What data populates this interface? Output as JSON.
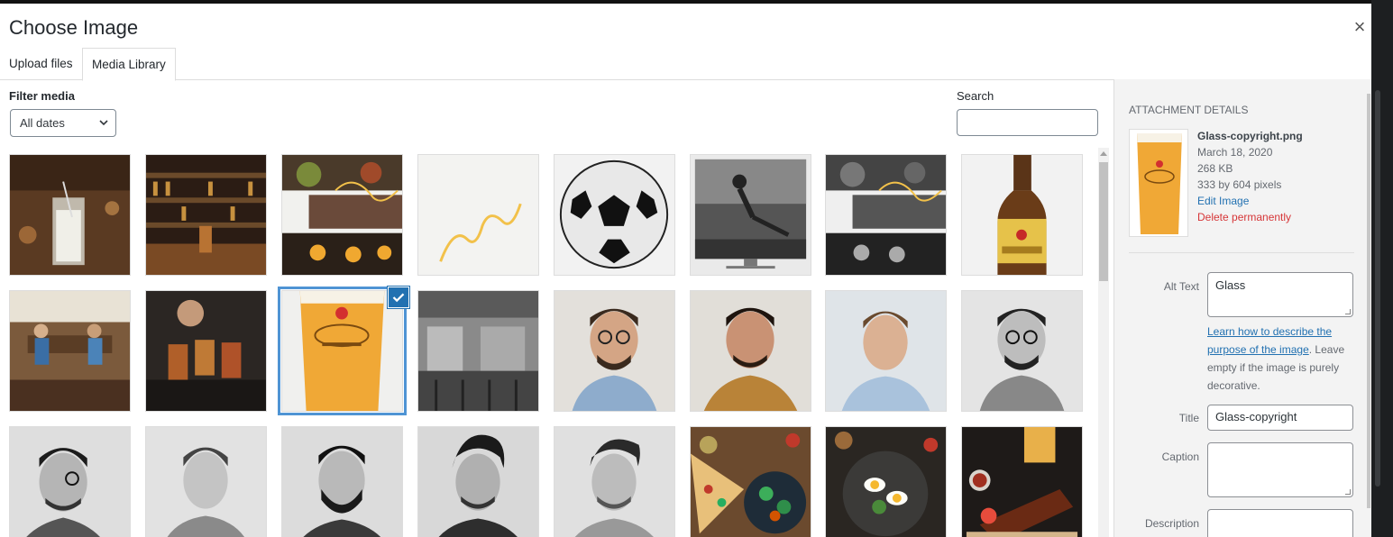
{
  "dialog": {
    "title": "Choose Image",
    "close_label": "×"
  },
  "tabs": [
    {
      "label": "Upload files",
      "active": false
    },
    {
      "label": "Media Library",
      "active": true
    }
  ],
  "filter": {
    "label": "Filter media",
    "date_value": "All dates"
  },
  "search": {
    "label": "Search",
    "value": ""
  },
  "grid": {
    "items": [
      {
        "name": "cocktail-glass"
      },
      {
        "name": "bar-shelves"
      },
      {
        "name": "food-collage-drinky"
      },
      {
        "name": "sporty-script"
      },
      {
        "name": "soccer-ball"
      },
      {
        "name": "football-tv"
      },
      {
        "name": "food-collage-drinky-bw"
      },
      {
        "name": "beer-bottle"
      },
      {
        "name": "bar-people"
      },
      {
        "name": "toasting-drinks"
      },
      {
        "name": "glass-copyright",
        "selected": true
      },
      {
        "name": "bar-interior-bw"
      },
      {
        "name": "man-glasses-portrait"
      },
      {
        "name": "man-smiling-portrait"
      },
      {
        "name": "young-man-portrait"
      },
      {
        "name": "man-glasses-bw"
      },
      {
        "name": "man-smiling-bw"
      },
      {
        "name": "young-man-bw"
      },
      {
        "name": "bearded-man-bw"
      },
      {
        "name": "curly-man-bw"
      },
      {
        "name": "man-styled-hair-bw"
      },
      {
        "name": "pizza-salad"
      },
      {
        "name": "egg-salad"
      },
      {
        "name": "ribs-fries"
      }
    ]
  },
  "attachment": {
    "heading": "Attachment Details",
    "filename": "Glass-copyright.png",
    "date": "March 18, 2020",
    "size": "268 KB",
    "dimensions": "333 by 604 pixels",
    "edit_label": "Edit Image",
    "delete_label": "Delete permanently",
    "alt_label": "Alt Text",
    "alt_value": "Glass",
    "alt_help_link": "Learn how to describe the purpose of the image",
    "alt_help_rest": ". Leave empty if the image is purely decorative.",
    "title_label": "Title",
    "title_value": "Glass-copyright",
    "caption_label": "Caption",
    "caption_value": "",
    "description_label": "Description",
    "description_value": ""
  },
  "colors": {
    "accent": "#2271b1",
    "danger": "#d63638",
    "selected_outline": "#4f94d4"
  }
}
